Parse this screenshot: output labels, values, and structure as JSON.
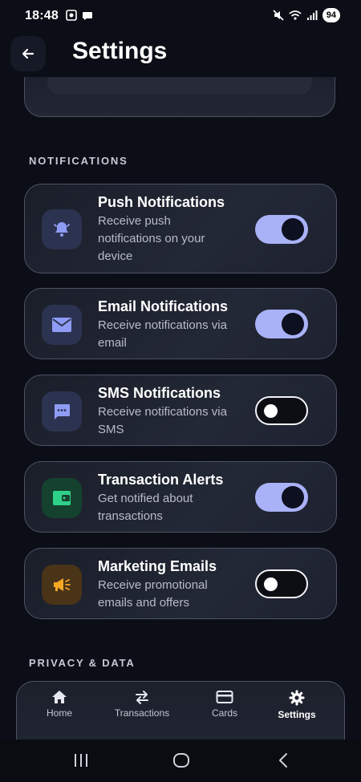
{
  "status_bar": {
    "time": "18:48",
    "battery": "94"
  },
  "header": {
    "title": "Settings",
    "back_icon": "arrow-left-icon"
  },
  "sections": {
    "notifications": "NOTIFICATIONS",
    "privacy": "PRIVACY & DATA"
  },
  "notifications": [
    {
      "title": "Push Notifications",
      "desc": "Receive push notifications on your device",
      "enabled": true,
      "icon": "bell-icon",
      "tile_color": "#2c3350",
      "icon_color": "#8f9cf5"
    },
    {
      "title": "Email Notifications",
      "desc": "Receive notifications via email",
      "enabled": true,
      "icon": "mail-icon",
      "tile_color": "#2c3350",
      "icon_color": "#8f9cf5"
    },
    {
      "title": "SMS Notifications",
      "desc": "Receive notifications via SMS",
      "enabled": false,
      "icon": "message-icon",
      "tile_color": "#2c3350",
      "icon_color": "#8f9cf5"
    },
    {
      "title": "Transaction Alerts",
      "desc": "Get notified about transactions",
      "enabled": true,
      "icon": "wallet-icon",
      "tile_color": "#14422f",
      "icon_color": "#2fd08a"
    },
    {
      "title": "Marketing Emails",
      "desc": "Receive promotional emails and offers",
      "enabled": false,
      "icon": "megaphone-icon",
      "tile_color": "#4a3418",
      "icon_color": "#f5a623"
    }
  ],
  "nav": [
    {
      "label": "Home",
      "icon": "home-icon",
      "active": false
    },
    {
      "label": "Transactions",
      "icon": "swap-icon",
      "active": false
    },
    {
      "label": "Cards",
      "icon": "card-icon",
      "active": false
    },
    {
      "label": "Settings",
      "icon": "gear-icon",
      "active": true
    }
  ]
}
